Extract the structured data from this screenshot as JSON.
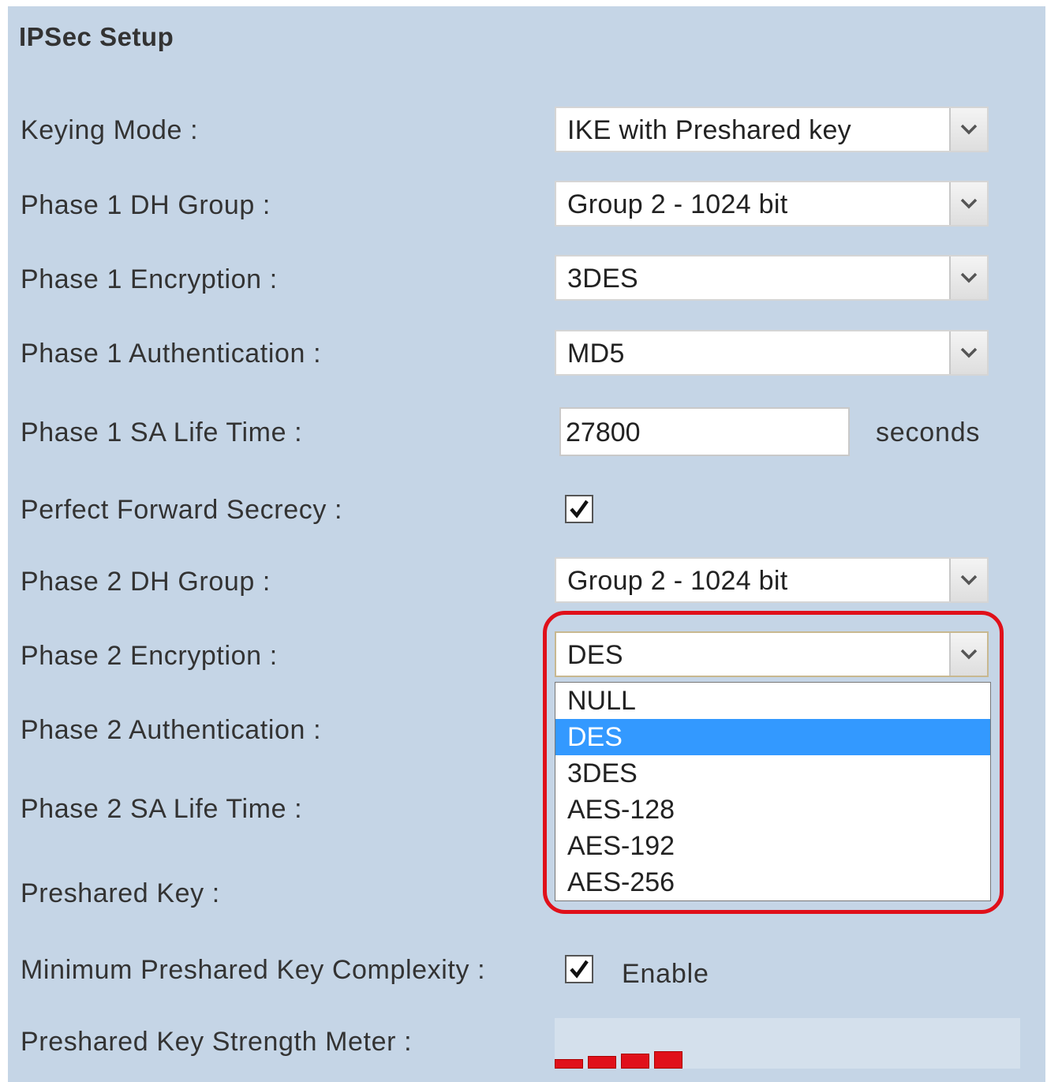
{
  "section_title": "IPSec Setup",
  "fields": {
    "keying_mode": {
      "label": "Keying Mode :",
      "value": "IKE with Preshared key"
    },
    "p1_dh_group": {
      "label": "Phase 1 DH Group :",
      "value": "Group 2 - 1024 bit"
    },
    "p1_encryption": {
      "label": "Phase 1 Encryption :",
      "value": "3DES"
    },
    "p1_auth": {
      "label": "Phase 1 Authentication :",
      "value": "MD5"
    },
    "p1_sa_life": {
      "label": "Phase 1 SA Life Time :",
      "value": "27800",
      "unit": "seconds"
    },
    "pfs": {
      "label": "Perfect Forward Secrecy :",
      "checked": true
    },
    "p2_dh_group": {
      "label": "Phase 2 DH Group :",
      "value": "Group 2 - 1024 bit"
    },
    "p2_encryption": {
      "label": "Phase 2 Encryption :",
      "value": "DES",
      "options": [
        "NULL",
        "DES",
        "3DES",
        "AES-128",
        "AES-192",
        "AES-256"
      ],
      "selected_index": 1
    },
    "p2_auth": {
      "label": "Phase 2 Authentication :"
    },
    "p2_sa_life": {
      "label": "Phase 2 SA Life Time :"
    },
    "preshared_key": {
      "label": "Preshared Key :"
    },
    "min_key_complexity": {
      "label": "Minimum Preshared Key Complexity :",
      "checked": true,
      "enable_label": "Enable"
    },
    "strength_meter": {
      "label": "Preshared Key Strength Meter :",
      "filled_segments": 4,
      "total_segments": 4
    }
  },
  "colors": {
    "panel_bg": "#c5d5e6",
    "highlight_ring": "#e0101a",
    "selected_option": "#3399ff",
    "meter_bar": "#e0101a"
  },
  "icons": {
    "select_arrow": "chevron-down-icon",
    "checkbox_mark": "checkmark-icon"
  }
}
